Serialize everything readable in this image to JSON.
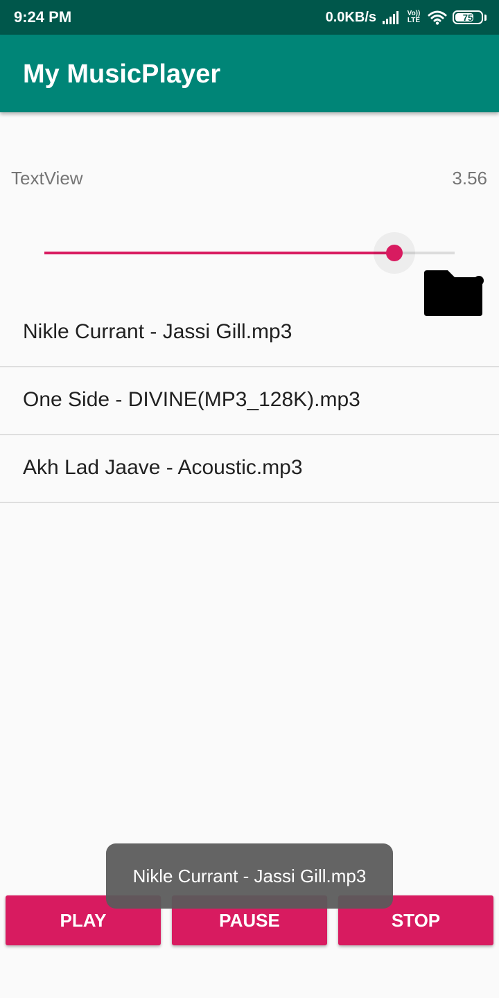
{
  "status_bar": {
    "time": "9:24 PM",
    "net_speed": "0.0KB/s",
    "volte_top": "Vo))",
    "volte_bottom": "LTE",
    "battery": "75",
    "battery_level": 0.75,
    "icons": [
      "signal-icon",
      "volte-icon",
      "wifi-icon",
      "battery-icon"
    ]
  },
  "app_bar": {
    "title": "My MusicPlayer"
  },
  "player": {
    "label": "TextView",
    "duration": "3.56",
    "progress": 0.853
  },
  "songs": [
    "Nikle Currant - Jassi Gill.mp3",
    "One Side - DIVINE(MP3_128K).mp3",
    "Akh Lad Jaave - Acoustic.mp3"
  ],
  "controls": {
    "play": "PLAY",
    "pause": "PAUSE",
    "stop": "STOP"
  },
  "toast": {
    "text": "Nikle Currant - Jassi Gill.mp3"
  },
  "colors": {
    "status_bar": "#00574b",
    "app_bar": "#008577",
    "accent": "#d81b60",
    "background": "#fafafa"
  }
}
